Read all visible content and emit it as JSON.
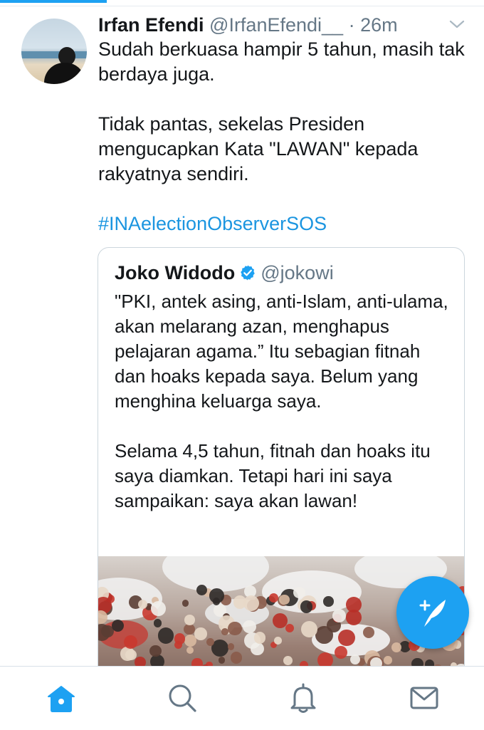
{
  "tweet": {
    "name": "Irfan Efendi",
    "handle": "@IrfanEfendi__",
    "separator": "·",
    "time": "26m",
    "text_lines": [
      "Sudah berkuasa hampir 5 tahun, masih tak berdaya juga.",
      "",
      "Tidak pantas, sekelas Presiden mengucapkan Kata \"LAWAN\" kepada rakyatnya sendiri."
    ],
    "hashtag": "#INAelectionObserverSOS"
  },
  "quoted_tweet": {
    "name": "Joko Widodo",
    "handle": "@jokowi",
    "paragraph_1": "\"PKI, antek asing, anti-Islam, anti-ulama, akan melarang azan, menghapus pelajaran agama.” Itu sebagian fitnah dan hoaks kepada saya. Belum yang menghina keluarga saya.",
    "paragraph_2": "Selama 4,5 tahun, fitnah dan hoaks itu saya diamkan. Tetapi hari ini saya sampaikan: saya akan lawan!"
  },
  "icons": {
    "verified": "verified-badge-icon",
    "chevron": "chevron-down-icon",
    "compose": "compose-tweet-icon",
    "tabs": [
      "home-icon",
      "search-icon",
      "notifications-icon",
      "messages-icon"
    ]
  },
  "colors": {
    "accent": "#1da1f2",
    "link": "#1b95e0",
    "secondary_text": "#657786",
    "border": "#ccd6dd"
  }
}
